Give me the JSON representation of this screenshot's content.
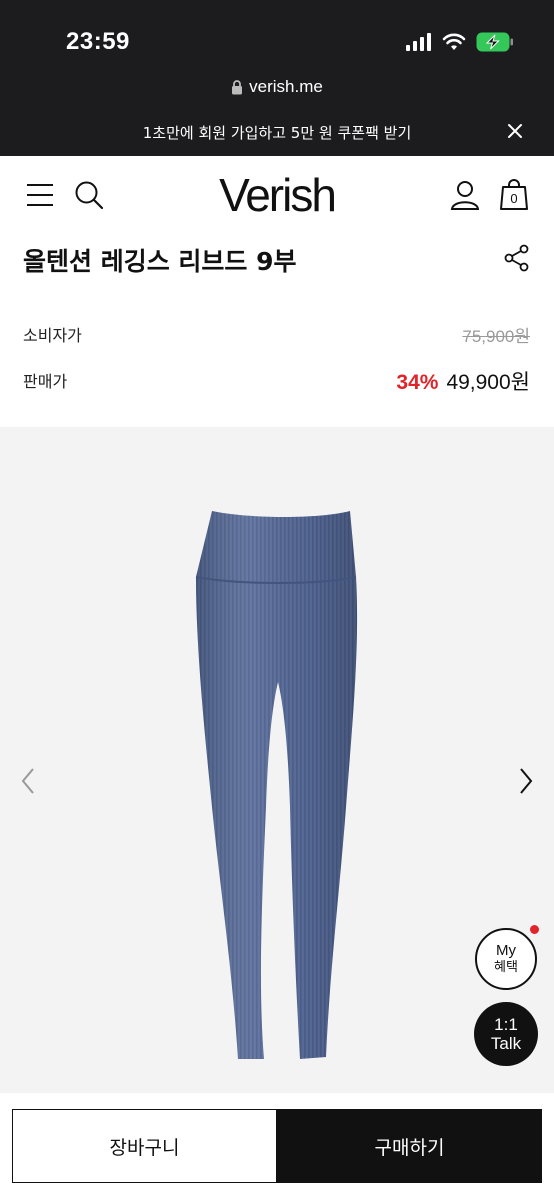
{
  "status_bar": {
    "time": "23:59"
  },
  "browser": {
    "url": "verish.me"
  },
  "promo_banner": {
    "text": "1초만에 회원 가입하고 5만 원 쿠폰팩 받기"
  },
  "header": {
    "logo": "Verish",
    "cart_count": "0"
  },
  "product": {
    "title": "올텐션 레깅스 리브드 9부",
    "consumer_price_label": "소비자가",
    "consumer_price": "75,900원",
    "sale_price_label": "판매가",
    "discount": "34%",
    "sale_price": "49,900원",
    "image_color": "#5a6e9c"
  },
  "floating": {
    "my_benefit_line1": "My",
    "my_benefit_line2": "혜택",
    "talk_line1": "1:1",
    "talk_line2": "Talk"
  },
  "bottom_bar": {
    "cart_label": "장바구니",
    "buy_label": "구매하기"
  },
  "icons": [
    "signal-icon",
    "wifi-icon",
    "battery-icon",
    "lock-icon",
    "close-icon",
    "menu-icon",
    "search-icon",
    "user-icon",
    "bag-icon",
    "share-icon",
    "chevron-left-icon",
    "chevron-right-icon"
  ],
  "colors": {
    "discount": "#e0242a",
    "dark_bar": "#1c1c1e",
    "battery": "#34c759"
  }
}
